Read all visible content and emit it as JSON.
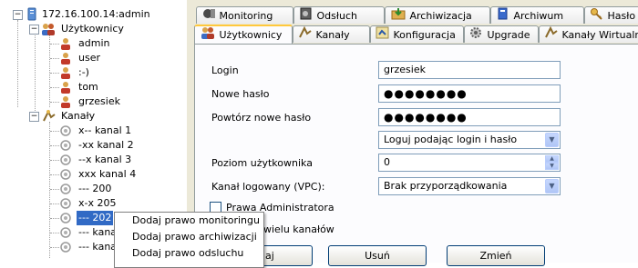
{
  "tree": {
    "root_label": "172.16.100.14:admin",
    "users_group": "Użytkownicy",
    "users": [
      "admin",
      "user",
      ":-)",
      "tom",
      "grzesiek"
    ],
    "channels_group": "Kanały",
    "channels": [
      "x-- kanal 1",
      "-xx kanal 2",
      "--x kanal 3",
      "xxx kanal 4",
      "--- 200",
      "x-x 205",
      "--- 202",
      "--- kana",
      "--- kana"
    ]
  },
  "context_menu": [
    "Dodaj prawo monitoringu",
    "Dodaj prawo archiwizacji",
    "Dodaj prawo odsluchu"
  ],
  "tabs_back": [
    "Monitoring",
    "Odsłuch",
    "Archiwizacja",
    "Archiwum",
    "Hasło"
  ],
  "tabs_front": [
    "Użytkownicy",
    "Kanały",
    "Konfiguracja",
    "Upgrade",
    "Kanały Wirtualne"
  ],
  "form": {
    "login_label": "Login",
    "login_value": "grzesiek",
    "new_password_label": "Nowe hasło",
    "new_password_value": "●●●●●●●●",
    "repeat_password_label": "Powtórz nowe hasło",
    "repeat_password_value": "●●●●●●●●",
    "login_mode_value": "Loguj podając login i hasło",
    "user_level_label": "Poziom użytkownika",
    "user_level_value": "0",
    "vpc_label": "Kanał logowany (VPC):",
    "vpc_value": "Brak przyporządkowania",
    "admin_rights_label": "Prawa Administratora",
    "multi_channel_label": "raw do wielu kanałów"
  },
  "buttons": {
    "add_label": "odaj",
    "delete_label": "Usuń",
    "change_label": "Zmień"
  },
  "colors": {
    "selection": "#316ac5",
    "tab_hot": "#ffc83c",
    "panel": "#ece9d8"
  }
}
